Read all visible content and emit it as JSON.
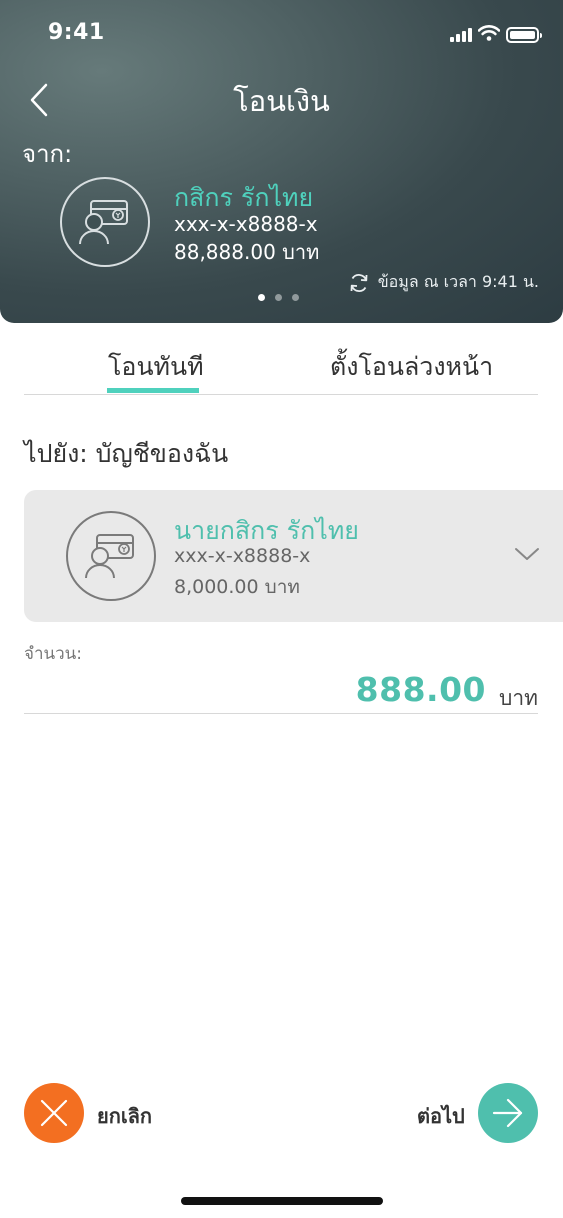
{
  "status_bar": {
    "time": "9:41"
  },
  "header": {
    "title": "โอนเงิน",
    "from_label": "จาก:"
  },
  "from_account": {
    "name": "กสิกร รักไทย",
    "number": "xxx-x-x8888-x",
    "balance": "88,888.00 บาท"
  },
  "refresh": {
    "text": "ข้อมูล ณ เวลา 9:41 น."
  },
  "tabs": [
    {
      "label": "โอนทันที",
      "active": true
    },
    {
      "label": "ตั้งโอนล่วงหน้า",
      "active": false
    }
  ],
  "to": {
    "label": "ไปยัง: บัญชีของฉัน"
  },
  "to_account": {
    "name": "นายกสิกร รักไทย",
    "number": "xxx-x-x8888-x",
    "balance": "8,000.00 บาท"
  },
  "amount": {
    "label": "จำนวน:",
    "value": "888.00",
    "unit": "บาท"
  },
  "actions": {
    "cancel_label": "ยกเลิก",
    "next_label": "ต่อไป"
  },
  "colors": {
    "accent": "#4fd1bd",
    "cancel": "#f36f21",
    "next": "#4fbfad"
  }
}
